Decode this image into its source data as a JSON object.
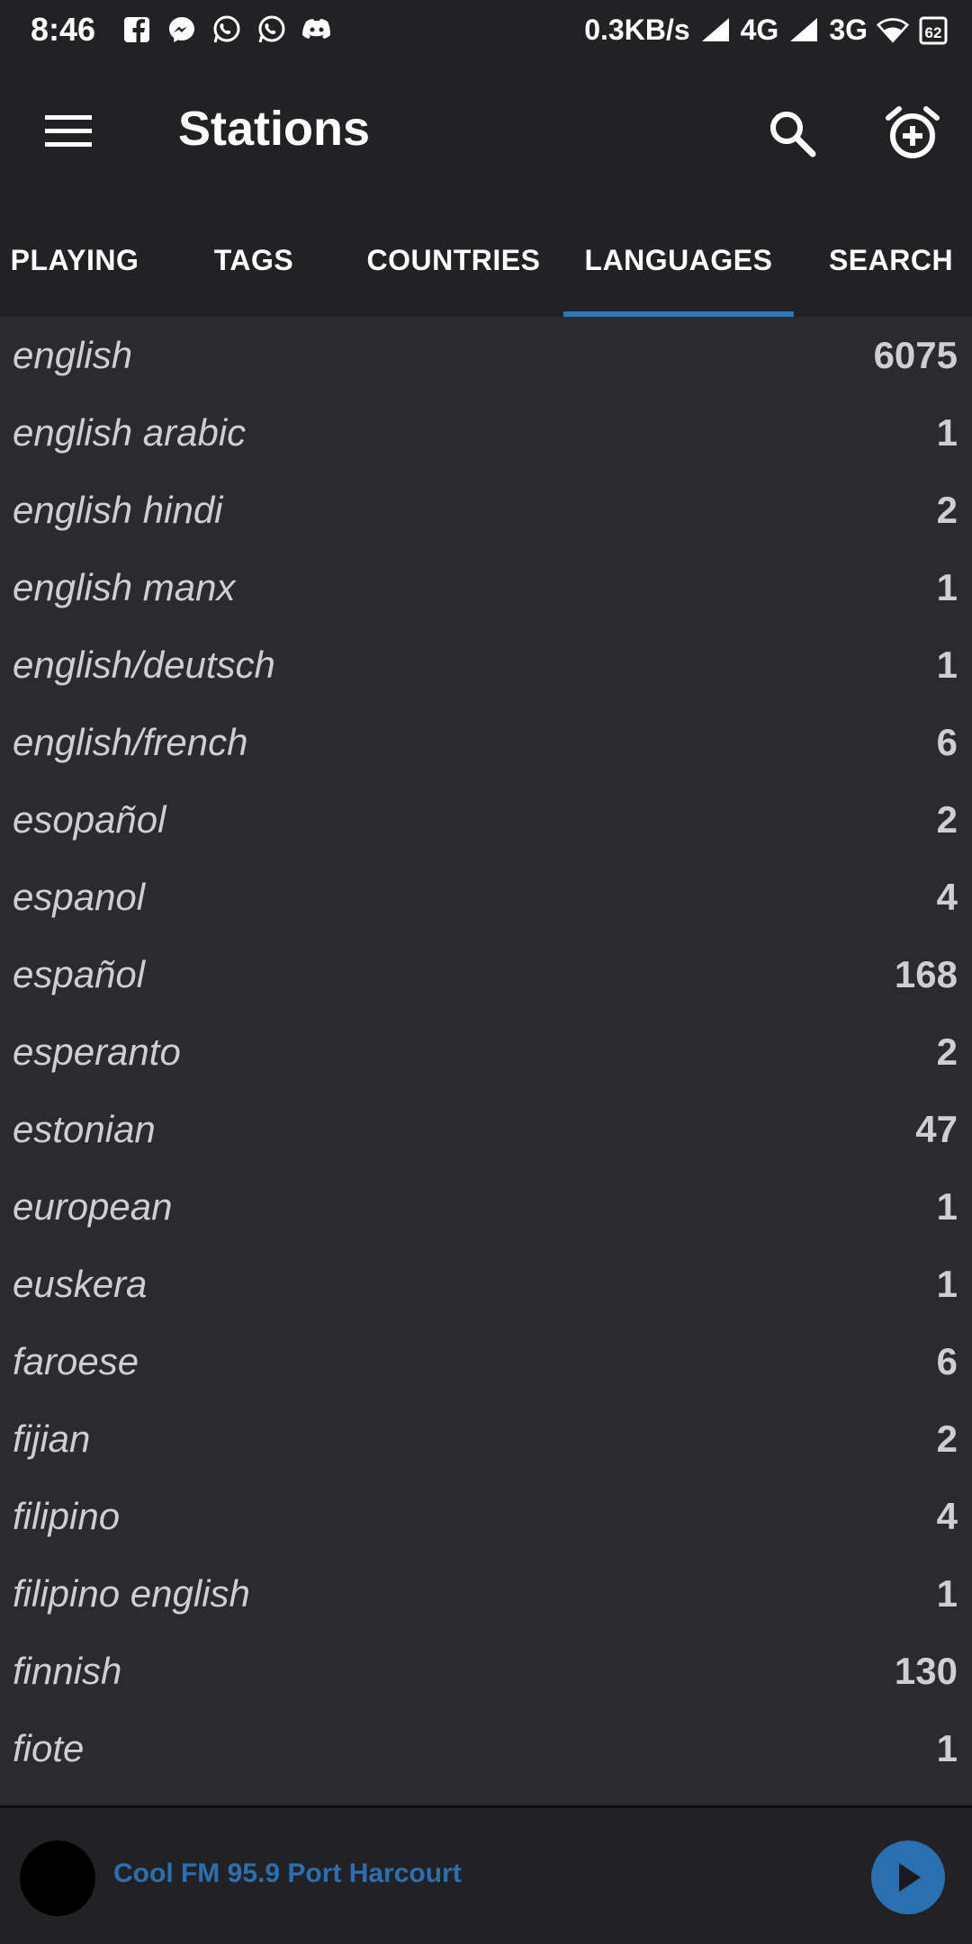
{
  "status_bar": {
    "time": "8:46",
    "net_speed": "0.3KB/s",
    "network_1": "4G",
    "network_2": "3G",
    "battery": "62",
    "icons_left": [
      "facebook-icon",
      "messenger-icon",
      "whatsapp-icon",
      "whatsapp-icon",
      "discord-icon"
    ]
  },
  "app_bar": {
    "title": "Stations",
    "icons": [
      "menu-icon",
      "search-icon",
      "alarm-add-icon"
    ]
  },
  "tabs": {
    "items": [
      "PLAYING",
      "TAGS",
      "COUNTRIES",
      "LANGUAGES",
      "SEARCH"
    ],
    "active": "LANGUAGES",
    "accent_color": "#2f77b5"
  },
  "languages": [
    {
      "name": "english",
      "count": "6075"
    },
    {
      "name": "english arabic",
      "count": "1"
    },
    {
      "name": "english hindi",
      "count": "2"
    },
    {
      "name": "english manx",
      "count": "1"
    },
    {
      "name": "english/deutsch",
      "count": "1"
    },
    {
      "name": "english/french",
      "count": "6"
    },
    {
      "name": "esopañol",
      "count": "2"
    },
    {
      "name": "espanol",
      "count": "4"
    },
    {
      "name": "español",
      "count": "168"
    },
    {
      "name": "esperanto",
      "count": "2"
    },
    {
      "name": "estonian",
      "count": "47"
    },
    {
      "name": "european",
      "count": "1"
    },
    {
      "name": "euskera",
      "count": "1"
    },
    {
      "name": "faroese",
      "count": "6"
    },
    {
      "name": "fijian",
      "count": "2"
    },
    {
      "name": "filipino",
      "count": "4"
    },
    {
      "name": "filipino english",
      "count": "1"
    },
    {
      "name": "finnish",
      "count": "130"
    },
    {
      "name": "fiote",
      "count": "1"
    }
  ],
  "player": {
    "station": "Cool FM 95.9 Port Harcourt",
    "accent_color": "#2a6fb0"
  }
}
